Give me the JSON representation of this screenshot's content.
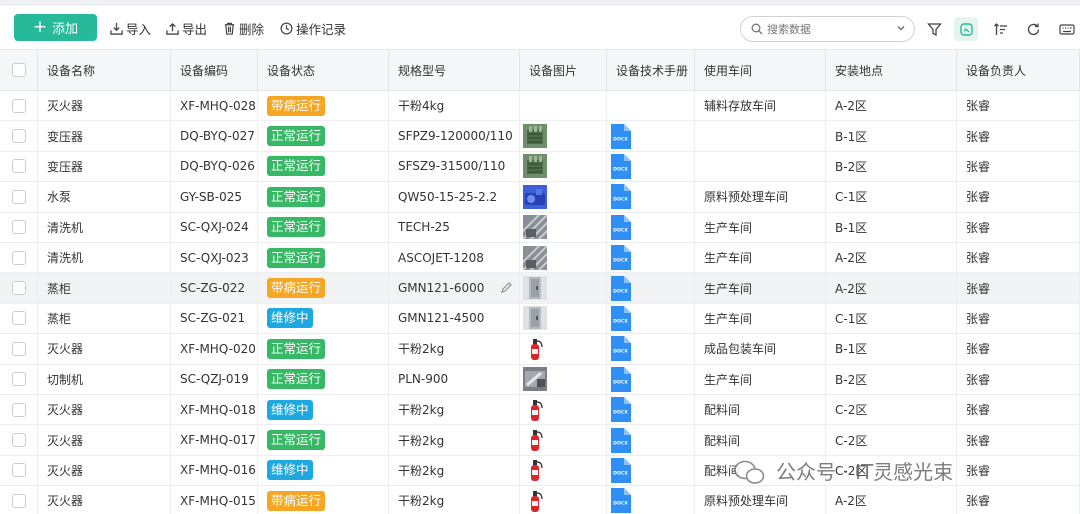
{
  "toolbar": {
    "add_label": "添加",
    "import_label": "导入",
    "export_label": "导出",
    "delete_label": "删除",
    "log_label": "操作记录",
    "search_placeholder": "搜索数据"
  },
  "table": {
    "columns": [
      "设备名称",
      "设备编码",
      "设备状态",
      "规格型号",
      "设备图片",
      "设备技术手册",
      "使用车间",
      "安装地点",
      "设备负责人"
    ],
    "status_colors": {
      "带病运行": "#f5a623",
      "正常运行": "#36b865",
      "维修中": "#1ea8e0"
    },
    "rows": [
      {
        "name": "灭火器",
        "code": "XF-MHQ-028",
        "status": "带病运行",
        "spec": "干粉4kg",
        "image": "",
        "manual": "",
        "workshop": "辅料存放车间",
        "location": "A-2区",
        "owner": "张睿"
      },
      {
        "name": "变压器",
        "code": "DQ-BYQ-027",
        "status": "正常运行",
        "spec": "SFPZ9-120000/110",
        "image": "transformer",
        "manual": "DOCX",
        "workshop": "",
        "location": "B-1区",
        "owner": "张睿"
      },
      {
        "name": "变压器",
        "code": "DQ-BYQ-026",
        "status": "正常运行",
        "spec": "SFSZ9-31500/110",
        "image": "transformer",
        "manual": "DOCX",
        "workshop": "",
        "location": "B-2区",
        "owner": "张睿"
      },
      {
        "name": "水泵",
        "code": "GY-SB-025",
        "status": "正常运行",
        "spec": "QW50-15-25-2.2",
        "image": "pump",
        "manual": "DOCX",
        "workshop": "原料预处理车间",
        "location": "C-1区",
        "owner": "张睿"
      },
      {
        "name": "清洗机",
        "code": "SC-QXJ-024",
        "status": "正常运行",
        "spec": "TECH-25",
        "image": "washer",
        "manual": "DOCX",
        "workshop": "生产车间",
        "location": "B-1区",
        "owner": "张睿"
      },
      {
        "name": "清洗机",
        "code": "SC-QXJ-023",
        "status": "正常运行",
        "spec": "ASCOJET-1208",
        "image": "washer",
        "manual": "DOCX",
        "workshop": "生产车间",
        "location": "A-2区",
        "owner": "张睿"
      },
      {
        "name": "蒸柜",
        "code": "SC-ZG-022",
        "status": "带病运行",
        "spec": "GMN121-6000",
        "image": "steamer",
        "manual": "DOCX",
        "workshop": "生产车间",
        "location": "A-2区",
        "owner": "张睿"
      },
      {
        "name": "蒸柜",
        "code": "SC-ZG-021",
        "status": "维修中",
        "spec": "GMN121-4500",
        "image": "steamer",
        "manual": "DOCX",
        "workshop": "生产车间",
        "location": "C-1区",
        "owner": "张睿"
      },
      {
        "name": "灭火器",
        "code": "XF-MHQ-020",
        "status": "正常运行",
        "spec": "干粉2kg",
        "image": "extinguisher",
        "manual": "DOCX",
        "workshop": "成品包装车间",
        "location": "B-1区",
        "owner": "张睿"
      },
      {
        "name": "切制机",
        "code": "SC-QZJ-019",
        "status": "正常运行",
        "spec": "PLN-900",
        "image": "cutter",
        "manual": "DOCX",
        "workshop": "生产车间",
        "location": "B-2区",
        "owner": "张睿"
      },
      {
        "name": "灭火器",
        "code": "XF-MHQ-018",
        "status": "维修中",
        "spec": "干粉2kg",
        "image": "extinguisher",
        "manual": "DOCX",
        "workshop": "配料间",
        "location": "C-2区",
        "owner": "张睿"
      },
      {
        "name": "灭火器",
        "code": "XF-MHQ-017",
        "status": "正常运行",
        "spec": "干粉2kg",
        "image": "extinguisher",
        "manual": "DOCX",
        "workshop": "配料间",
        "location": "C-2区",
        "owner": "张睿"
      },
      {
        "name": "灭火器",
        "code": "XF-MHQ-016",
        "status": "维修中",
        "spec": "干粉2kg",
        "image": "extinguisher",
        "manual": "DOCX",
        "workshop": "配料间",
        "location": "C-2区",
        "owner": "张睿"
      },
      {
        "name": "灭火器",
        "code": "XF-MHQ-015",
        "status": "带病运行",
        "spec": "干粉2kg",
        "image": "extinguisher",
        "manual": "DOCX",
        "workshop": "原料预处理车间",
        "location": "A-2区",
        "owner": "张睿"
      }
    ]
  },
  "watermark": "公众号 · IT灵感光束"
}
